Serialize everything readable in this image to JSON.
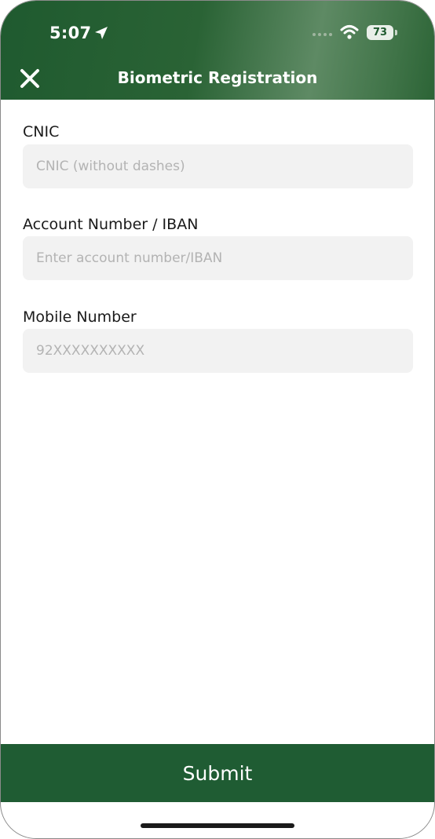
{
  "status_bar": {
    "time": "5:07",
    "battery": "73",
    "icons": [
      "location-arrow-icon",
      "signal-icon",
      "wifi-icon",
      "battery-icon"
    ]
  },
  "header": {
    "title": "Biometric Registration",
    "close_icon": "close-icon"
  },
  "form": {
    "cnic": {
      "label": "CNIC",
      "placeholder": "CNIC (without dashes)",
      "value": ""
    },
    "account": {
      "label": "Account Number / IBAN",
      "placeholder": "Enter account number/IBAN",
      "value": ""
    },
    "mobile": {
      "label": "Mobile Number",
      "placeholder": "92XXXXXXXXXX",
      "value": ""
    }
  },
  "submit_label": "Submit",
  "colors": {
    "brand_green": "#1f5c33",
    "input_bg": "#f2f2f2",
    "placeholder": "#b3b3b3"
  }
}
